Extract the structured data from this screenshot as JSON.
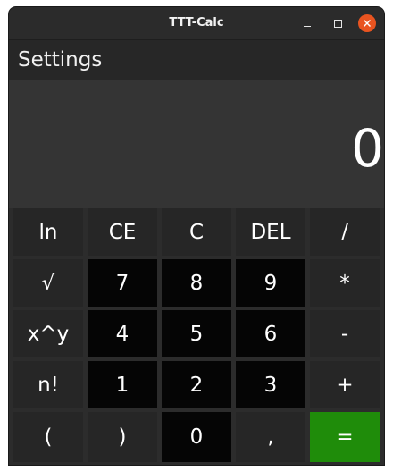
{
  "window": {
    "title": "TTT-Calc"
  },
  "menu": {
    "settings": "Settings"
  },
  "display": {
    "value": "0"
  },
  "colors": {
    "equals_key": "#1f8c0a",
    "close_button": "#e95420"
  },
  "icons": {
    "minimize": "minimize-icon",
    "maximize": "maximize-icon",
    "close": "close-icon"
  },
  "keys": {
    "ln": "ln",
    "ce": "CE",
    "clear": "C",
    "del": "DEL",
    "divide": "/",
    "sqrt": "√",
    "seven": "7",
    "eight": "8",
    "nine": "9",
    "multiply": "*",
    "power": "x^y",
    "four": "4",
    "five": "5",
    "six": "6",
    "minus": "-",
    "factorial": "n!",
    "one": "1",
    "two": "2",
    "three": "3",
    "plus": "+",
    "open_paren": "(",
    "close_paren": ")",
    "zero": "0",
    "decimal": ",",
    "equals": "="
  }
}
